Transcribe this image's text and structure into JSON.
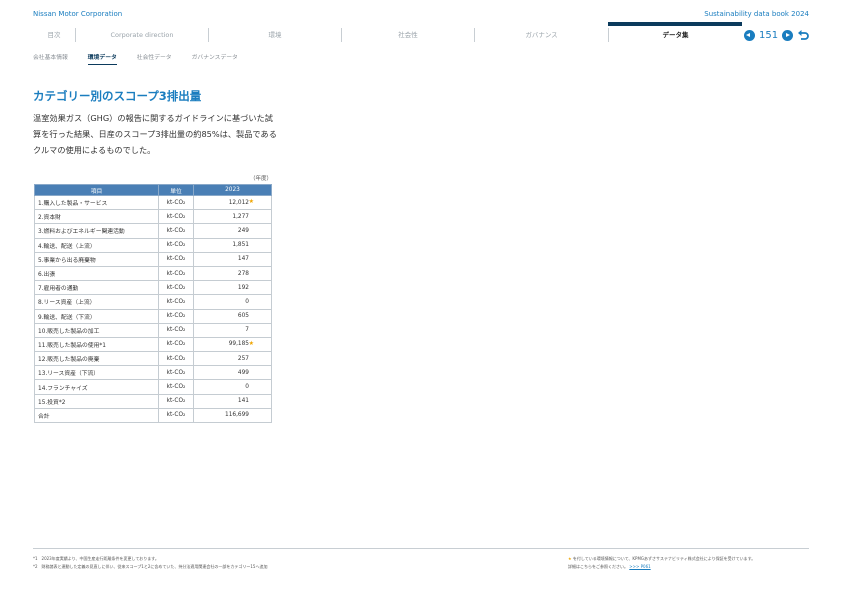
{
  "header": {
    "company": "Nissan Motor Corporation",
    "book_title": "Sustainability data book 2024"
  },
  "nav": {
    "items": [
      "目次",
      "Corporate direction",
      "環境",
      "社会性",
      "ガバナンス"
    ],
    "active": "データ集"
  },
  "pager": {
    "page": "151"
  },
  "subnav": {
    "items": [
      "会社基本情報",
      "環境データ",
      "社会性データ",
      "ガバナンスデータ"
    ]
  },
  "title": "カテゴリー別のスコープ3排出量",
  "description": "温室効果ガス（GHG）の報告に関するガイドラインに基づいた試算を行った結果、日産のスコープ3排出量の約85%は、製品であるクルマの使用によるものでした。",
  "unit_note": "（年度）",
  "table": {
    "headers": [
      "項目",
      "単位",
      "2023"
    ],
    "rows": [
      {
        "item": "1.購入した製品・サービス",
        "unit": "kt-CO₂",
        "value": "12,012",
        "star": "★"
      },
      {
        "item": "2.資本財",
        "unit": "kt-CO₂",
        "value": "1,277",
        "star": ""
      },
      {
        "item": "3.燃料およびエネルギー関連活動",
        "unit": "kt-CO₂",
        "value": "249",
        "star": ""
      },
      {
        "item": "4.輸送、配送（上流）",
        "unit": "kt-CO₂",
        "value": "1,851",
        "star": ""
      },
      {
        "item": "5.事業から出る廃棄物",
        "unit": "kt-CO₂",
        "value": "147",
        "star": ""
      },
      {
        "item": "6.出張",
        "unit": "kt-CO₂",
        "value": "278",
        "star": ""
      },
      {
        "item": "7.雇用者の通勤",
        "unit": "kt-CO₂",
        "value": "192",
        "star": ""
      },
      {
        "item": "8.リース資産（上流）",
        "unit": "kt-CO₂",
        "value": "0",
        "star": ""
      },
      {
        "item": "9.輸送、配送（下流）",
        "unit": "kt-CO₂",
        "value": "605",
        "star": ""
      },
      {
        "item": "10.販売した製品の加工",
        "unit": "kt-CO₂",
        "value": "7",
        "star": ""
      },
      {
        "item": "11.販売した製品の使用*1",
        "unit": "kt-CO₂",
        "value": "99,185",
        "star": "★"
      },
      {
        "item": "12.販売した製品の廃棄",
        "unit": "kt-CO₂",
        "value": "257",
        "star": ""
      },
      {
        "item": "13.リース資産（下流）",
        "unit": "kt-CO₂",
        "value": "499",
        "star": ""
      },
      {
        "item": "14.フランチャイズ",
        "unit": "kt-CO₂",
        "value": "0",
        "star": ""
      },
      {
        "item": "15.投資*2",
        "unit": "kt-CO₂",
        "value": "141",
        "star": ""
      },
      {
        "item": "合計",
        "unit": "kt-CO₂",
        "value": "116,699",
        "star": ""
      }
    ]
  },
  "footnotes": {
    "left": [
      "*1　2023年度実績より、中国生産走行距離条件を変更しております。",
      "*2　財務諸表と連動した定義の見直しに伴い、従来スコープ1と2に含めていた、持分法適用関連会社の一部をカテゴリー15へ追加"
    ],
    "right_star": "★",
    "right_line1": "を付している環境情報について、KPMGあずさサステナビリティ株式会社により保証を受けています。",
    "right_line2": "詳細はこちらをご参照ください。",
    "right_link": ">>> P061"
  },
  "colors": {
    "accent": "#1a7dbf",
    "nav_active_bar": "#0b3a5c",
    "table_header": "#4a7fb5",
    "star": "#f0a500"
  }
}
